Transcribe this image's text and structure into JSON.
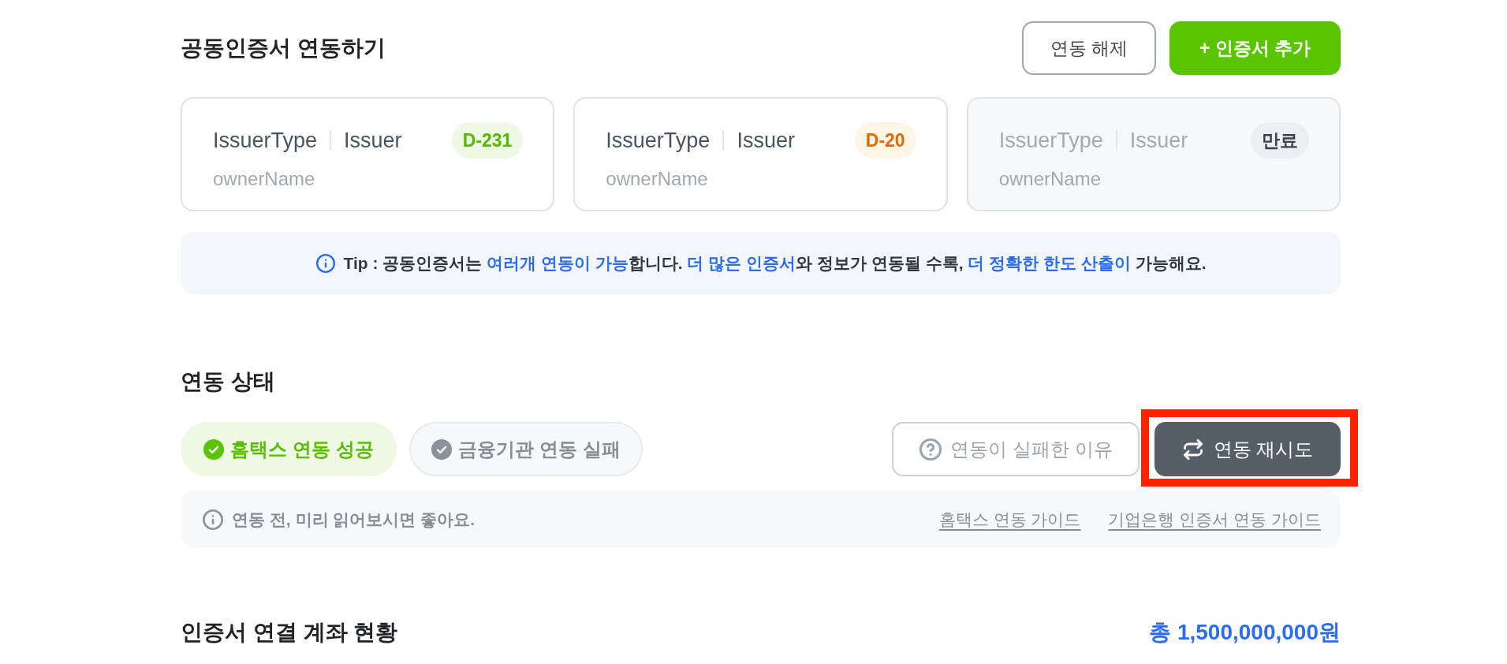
{
  "certificates": {
    "title": "공동인증서 연동하기",
    "buttons": [
      {
        "label": "연동 해제",
        "kind": "outline"
      },
      {
        "label": "+ 인증서 추가",
        "kind": "primary"
      }
    ],
    "cards": [
      {
        "issuer_type": "IssuerType",
        "issuer": "Issuer",
        "owner": "ownerName",
        "expired": false,
        "badge": {
          "label": "D-231",
          "kind": "ok"
        }
      },
      {
        "issuer_type": "IssuerType",
        "issuer": "Issuer",
        "owner": "ownerName",
        "expired": false,
        "badge": {
          "label": "D-20",
          "kind": "warning"
        }
      },
      {
        "issuer_type": "IssuerType",
        "issuer": "Issuer",
        "owner": "ownerName",
        "expired": true,
        "badge": {
          "label": "만료",
          "kind": "expired"
        }
      }
    ],
    "tip": {
      "segments": [
        {
          "text": "Tip : 공동인증서는 ",
          "highlight": false
        },
        {
          "text": "여러개 연동이 가능",
          "highlight": true
        },
        {
          "text": "합니다. ",
          "highlight": false
        },
        {
          "text": "더 많은 인증서",
          "highlight": true
        },
        {
          "text": "와 정보가 연동될 수록, ",
          "highlight": false
        },
        {
          "text": "더 정확한 한도 산출이",
          "highlight": true
        },
        {
          "text": " 가능해요.",
          "highlight": false
        }
      ]
    }
  },
  "status": {
    "title": "연동 상태",
    "items": [
      {
        "label": "홈택스 연동 성공",
        "kind": "success"
      },
      {
        "label": "금융기관 연동 실패",
        "kind": "failure"
      }
    ],
    "reason_button": {
      "label": "연동이 실패한 이유",
      "disabled": true
    },
    "retry_button": {
      "label": "연동 재시도",
      "highlighted": true
    },
    "guide": {
      "note": "연동 전, 미리 읽어보시면 좋아요.",
      "links": [
        "홈택스 연동 가이드",
        "기업은행 인증서 연동 가이드"
      ]
    }
  },
  "accounts": {
    "title": "인증서 연결 계좌 현황",
    "total": "총 1,500,000,000원"
  }
}
